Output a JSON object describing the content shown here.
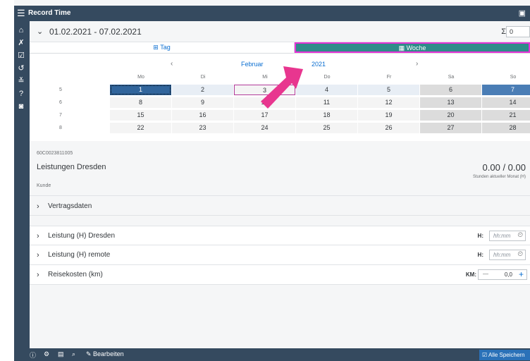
{
  "app": {
    "title": "Record Time"
  },
  "week": {
    "range": "01.02.2021 - 07.02.2021",
    "sum_symbol": "Σ",
    "sum_value": "0"
  },
  "view": {
    "tag_label": "Tag",
    "woche_label": "Woche"
  },
  "calendar": {
    "month": "Februar",
    "year": "2021",
    "prev": "‹",
    "next": "›",
    "days": [
      "Mo",
      "Di",
      "Mi",
      "Do",
      "Fr",
      "Sa",
      "So"
    ],
    "weeks": [
      {
        "num": "5",
        "dates": [
          "1",
          "2",
          "3",
          "4",
          "5",
          "6",
          "7"
        ]
      },
      {
        "num": "6",
        "dates": [
          "8",
          "9",
          "10",
          "11",
          "12",
          "13",
          "14"
        ]
      },
      {
        "num": "7",
        "dates": [
          "15",
          "16",
          "17",
          "18",
          "19",
          "20",
          "21"
        ]
      },
      {
        "num": "8",
        "dates": [
          "22",
          "23",
          "24",
          "25",
          "26",
          "27",
          "28"
        ]
      }
    ]
  },
  "project": {
    "code": "60C0023811005",
    "name": "Leistungen Dresden",
    "customer_label": "Kunde",
    "hours": "0.00 / 0.00",
    "hours_label": "Stunden aktueller Monat (H)"
  },
  "sections": {
    "vertragsdaten": "Vertragsdaten",
    "leistung_dresden": "Leistung (H) Dresden",
    "leistung_remote": "Leistung (H) remote",
    "reisekosten": "Reisekosten (km)",
    "h_label": "H:",
    "km_label": "KM:",
    "time_placeholder": "hh:mm",
    "km_value": "0,0"
  },
  "footer": {
    "edit_label": "Bearbeiten",
    "save_all_label": "Alle Speichern"
  },
  "colors": {
    "shell": "#354a5f",
    "accent": "#0a6ed1",
    "woche_active": "#2e8c8a",
    "highlight": "#e532d6",
    "arrow": "#e8368f"
  }
}
